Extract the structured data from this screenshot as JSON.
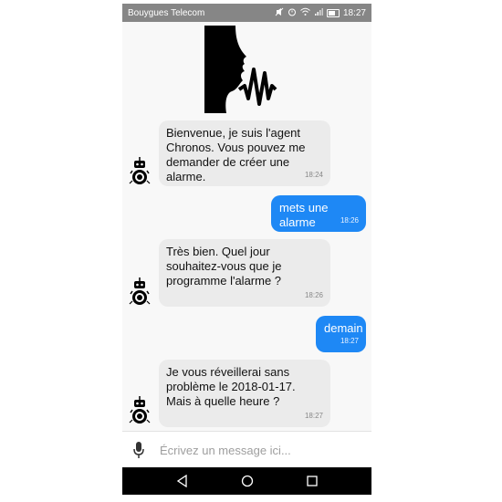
{
  "status_bar": {
    "carrier": "Bouygues Telecom",
    "time": "18:27",
    "icons": [
      "mute-icon",
      "alarm-icon",
      "wifi-icon",
      "signal-icon",
      "battery-icon"
    ]
  },
  "chat": {
    "messages": [
      {
        "from": "bot",
        "text": "Bienvenue, je suis l'agent Chronos. Vous pouvez me demander de créer une alarme.",
        "time": "18:24"
      },
      {
        "from": "user",
        "text": "mets une alarme",
        "time": "18:26"
      },
      {
        "from": "bot",
        "text": "Très bien. Quel jour souhaitez-vous que je programme l'alarme ?",
        "time": "18:26"
      },
      {
        "from": "user",
        "text": "demain",
        "time": "18:27"
      },
      {
        "from": "bot",
        "text": "Je vous réveillerai sans problème le 2018-01-17. Mais à quelle heure ?",
        "time": "18:27"
      }
    ]
  },
  "input": {
    "placeholder": "Écrivez un message ici..."
  },
  "nav": {
    "icons": [
      "back-icon",
      "home-icon",
      "recents-icon"
    ]
  },
  "colors": {
    "user_bubble": "#1e88f5",
    "bot_bubble": "#ebebeb",
    "status_bar": "#868686",
    "nav_bar": "#000000"
  }
}
